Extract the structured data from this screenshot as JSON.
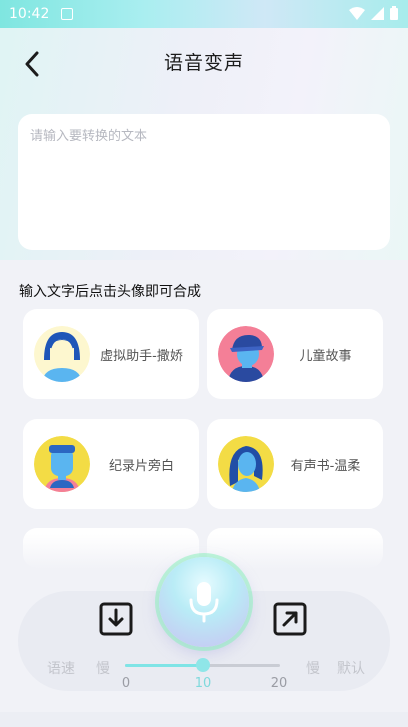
{
  "status_bar": {
    "time": "10:42"
  },
  "header": {
    "title": "语音变声"
  },
  "text_input": {
    "placeholder": "请输入要转换的文本",
    "value": ""
  },
  "section": {
    "label": "输入文字后点击头像即可合成"
  },
  "voices": [
    {
      "name": "虚拟助手-撒娇",
      "avatar_bg": "#fdf7cf",
      "hair": "#1f56b8"
    },
    {
      "name": "儿童故事",
      "avatar_bg": "#f47f97",
      "hair": "#2a4aa0"
    },
    {
      "name": "纪录片旁白",
      "avatar_bg": "#f3dc45",
      "hair": "#2b67c2"
    },
    {
      "name": "有声书-温柔",
      "avatar_bg": "#f3dc45",
      "hair": "#214ea6"
    }
  ],
  "controls": {
    "speed_label": "语速",
    "slow_left": "慢",
    "slow_right": "慢",
    "default_label": "默认",
    "speed_value": 10,
    "speed_range": [
      0,
      20
    ],
    "ticks": [
      "0",
      "10",
      "20"
    ]
  },
  "colors": {
    "accent": "#7fe4e6",
    "brand_gradient_start": "#7fe6e0"
  }
}
